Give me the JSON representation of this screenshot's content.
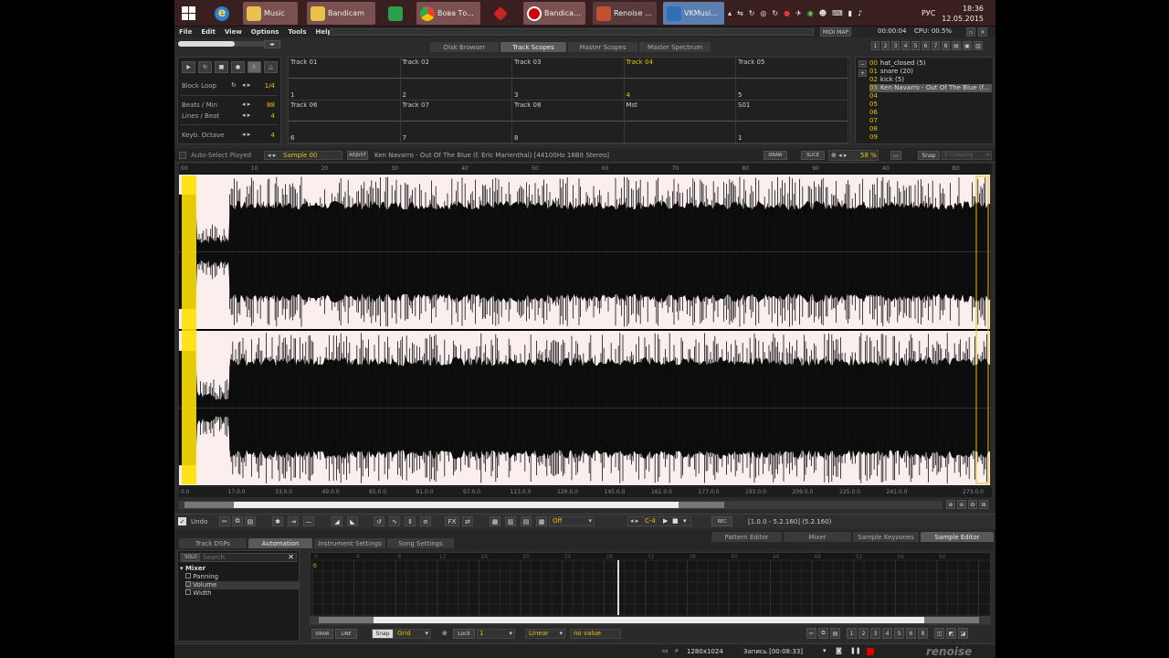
{
  "taskbar": {
    "buttons": [
      {
        "label": "Music"
      },
      {
        "label": "Bandicam"
      },
      {
        "label": "Вова То..."
      },
      {
        "label": "Bandica..."
      },
      {
        "label": "Renoise ..."
      },
      {
        "label": "VKMusi..."
      }
    ],
    "lang": "РУС",
    "time": "18:36",
    "date": "12.05.2015"
  },
  "menu": {
    "items": [
      "File",
      "Edit",
      "View",
      "Options",
      "Tools",
      "Help"
    ]
  },
  "topbar": {
    "midi_map": "MIDI MAP",
    "time": "00:00:04",
    "cpu": "CPU: 00.5%"
  },
  "top_tabs": [
    "Disk Browser",
    "Track Scopes",
    "Master Scopes",
    "Master Spectrum"
  ],
  "transport": {
    "block_loop_label": "Block Loop",
    "block_loop_value": "1/4",
    "bpm_label": "Beats / Min",
    "bpm_value": "88",
    "lpb_label": "Lines / Beat",
    "lpb_value": "4",
    "octave_label": "Keyb. Octave",
    "octave_value": "4"
  },
  "scopes": [
    {
      "name": "Track 01",
      "num": "1"
    },
    {
      "name": "Track 02",
      "num": "2"
    },
    {
      "name": "Track 03",
      "num": "3"
    },
    {
      "name": "Track 04",
      "num": "4"
    },
    {
      "name": "Track 05",
      "num": "5"
    },
    {
      "name": "Track 06",
      "num": "6"
    },
    {
      "name": "Track 07",
      "num": "7"
    },
    {
      "name": "Track 08",
      "num": "8"
    },
    {
      "name": "Mst",
      "num": ""
    },
    {
      "name": "S01",
      "num": "1"
    }
  ],
  "instruments": [
    {
      "idx": "00",
      "name": "hat_closed (5)"
    },
    {
      "idx": "01",
      "name": "snare (20)"
    },
    {
      "idx": "02",
      "name": "kick (5)"
    },
    {
      "idx": "03",
      "name": "Ken Navarro - Out Of The Blue (f..."
    },
    {
      "idx": "04",
      "name": ""
    },
    {
      "idx": "05",
      "name": ""
    },
    {
      "idx": "06",
      "name": ""
    },
    {
      "idx": "07",
      "name": ""
    },
    {
      "idx": "08",
      "name": ""
    },
    {
      "idx": "09",
      "name": ""
    }
  ],
  "sample_bar": {
    "auto_select": "Auto-Select Played",
    "sample": "Sample 00",
    "adjust": "ADJUST",
    "info": "Ken Navarro - Out Of The Blue (f. Eric Marienthal) [44100Hz 16Bit Stereo]",
    "draw": "DRAW",
    "slice": "SLICE",
    "zoom": "58 %",
    "snap": "Snap",
    "snap_value": "0 Crossing"
  },
  "waveform": {
    "ruler_ticks": [
      "00",
      "10",
      "20",
      "30",
      "40",
      "50",
      "60",
      "70",
      "80",
      "90",
      "A0",
      "B0"
    ],
    "bottom_ticks": [
      "0.0",
      "17.0.0",
      "33.0.0",
      "49.0.0",
      "65.0.0",
      "81.0.0",
      "97.0.0",
      "113.0.0",
      "129.0.0",
      "145.0.0",
      "161.0.0",
      "177.0.0",
      "193.0.0",
      "209.0.0",
      "225.0.0",
      "241.0.0",
      "273.0.0"
    ]
  },
  "sample_toolbar": {
    "undo": "Undo",
    "fx": "FX",
    "off": "Off",
    "note": "C-4",
    "rec": "REC",
    "selection": "[1.0.0 - 5.2.160] (5.2.160)"
  },
  "lower_tabs_left": [
    "Track DSPs",
    "Automation",
    "Instrument Settings",
    "Song Settings"
  ],
  "lower_tabs_right": [
    "Pattern Editor",
    "Mixer",
    "Sample Keyzones",
    "Sample Editor"
  ],
  "automation": {
    "search_placeholder": "Search",
    "group": "Mixer",
    "params": [
      "Panning",
      "Volume",
      "Width"
    ],
    "ruler": [
      "0",
      "4",
      "8",
      "12",
      "16",
      "20",
      "24",
      "28",
      "32",
      "36",
      "40",
      "44",
      "48",
      "52",
      "56",
      "60"
    ],
    "row_value": "0",
    "draw": "DRAW",
    "line": "LINE",
    "snap": "Snap",
    "grid": "Grid",
    "lock": "Lock",
    "lock_value": "1",
    "mode": "Linear",
    "value": "no value"
  },
  "status": {
    "resolution": "1280x1024",
    "recording": "Запись [00:08:33]",
    "brand": "renoise"
  }
}
